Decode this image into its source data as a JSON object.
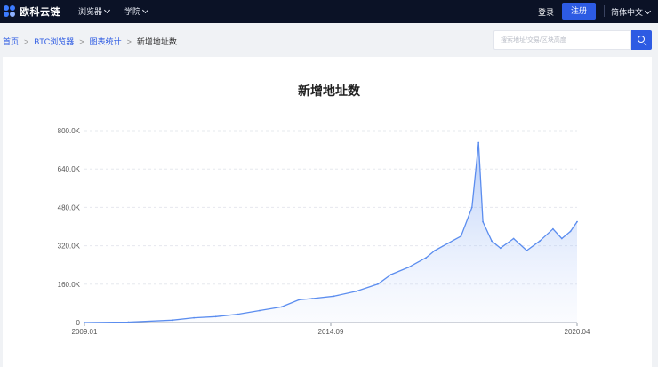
{
  "header": {
    "brand": "欧科云链",
    "nav": [
      {
        "label": "浏览器"
      },
      {
        "label": "学院"
      }
    ],
    "login": "登录",
    "register": "注册",
    "language": "简体中文"
  },
  "breadcrumb": {
    "items": [
      "首页",
      "BTC浏览器",
      "图表统计"
    ],
    "separator": ">",
    "current": "新增地址数"
  },
  "search": {
    "placeholder": "搜索地址/交易/区块高度"
  },
  "colors": {
    "topbar": "#0b1226",
    "accent": "#2d5be3",
    "line": "#5b8def",
    "fill": "#dfe8fd"
  },
  "chart_data": {
    "type": "area",
    "title": "新增地址数",
    "xlabel": "",
    "ylabel": "",
    "ylim": [
      0,
      800000
    ],
    "yticks": [
      {
        "value": 0,
        "label": "0"
      },
      {
        "value": 160000,
        "label": "160.0K"
      },
      {
        "value": 320000,
        "label": "320.0K"
      },
      {
        "value": 480000,
        "label": "480.0K"
      },
      {
        "value": 640000,
        "label": "640.0K"
      },
      {
        "value": 800000,
        "label": "800.0K"
      }
    ],
    "xticks": [
      "2009.01",
      "2014.09",
      "2020.04"
    ],
    "xrange": [
      2009.0,
      2020.25
    ],
    "grid": true,
    "series": [
      {
        "x": [
          2009.0,
          2010.0,
          2011.0,
          2011.5,
          2012.0,
          2012.5,
          2013.0,
          2013.5,
          2013.9,
          2014.2,
          2014.7,
          2015.2,
          2015.7,
          2016.0,
          2016.4,
          2016.8,
          2017.0,
          2017.3,
          2017.6,
          2017.85,
          2018.0,
          2018.1,
          2018.3,
          2018.5,
          2018.8,
          2019.1,
          2019.4,
          2019.7,
          2019.9,
          2020.1,
          2020.25
        ],
        "values": [
          0,
          2000,
          10000,
          20000,
          25000,
          35000,
          50000,
          65000,
          95000,
          100000,
          110000,
          130000,
          160000,
          200000,
          230000,
          270000,
          300000,
          330000,
          360000,
          480000,
          750000,
          420000,
          340000,
          310000,
          350000,
          300000,
          340000,
          390000,
          350000,
          380000,
          420000
        ]
      }
    ]
  }
}
